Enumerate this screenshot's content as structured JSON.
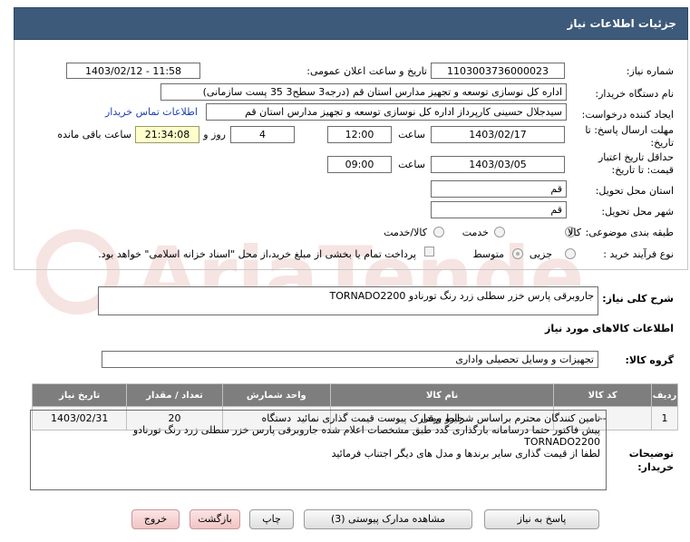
{
  "title": "جزئیات اطلاعات نیاز",
  "fields": {
    "need_number_label": "شماره نیاز:",
    "need_number": "1103003736000023",
    "announce_label": "تاریخ و ساعت اعلان عمومی:",
    "announce_value": "1403/02/12 - 11:58",
    "buyer_org_label": "نام دستگاه خریدار:",
    "buyer_org": "اداره کل نوسازی   توسعه و تجهیز مدارس استان قم (درجه3 سطح3  35 پست سازمانی)",
    "creator_label": "ایجاد کننده درخواست:",
    "creator": "سیدجلال حسینی کارپرداز اداره کل نوسازی   توسعه و تجهیز مدارس استان قم",
    "contact_link": "اطلاعات تماس خریدار",
    "reply_deadline_label": "مهلت ارسال پاسخ: تا تاریخ:",
    "reply_date": "1403/02/17",
    "time_label": "ساعت",
    "reply_time": "12:00",
    "days_value": "4",
    "days_label": "روز و",
    "remaining_time": "21:34:08",
    "remaining_label": "ساعت باقی مانده",
    "validity_label": "حداقل تاریخ اعتبار قیمت: تا تاریخ:",
    "validity_date": "1403/03/05",
    "validity_time": "09:00",
    "province_label": "استان محل تحویل:",
    "province": "قم",
    "city_label": "شهر محل تحویل:",
    "city": "قم",
    "category_label": "طبقه بندی موضوعی:",
    "cat_goods": "کالا",
    "cat_service": "خدمت",
    "cat_goods_service": "کالا/خدمت",
    "purchase_type_label": "نوع فرآیند خرید :",
    "type_minor": "جزیی",
    "type_medium": "متوسط",
    "payment_note": "پرداخت تمام یا بخشی از مبلغ خرید،از محل \"اسناد خزانه اسلامی\" خواهد بود."
  },
  "summary": {
    "label": "شرح کلی نیاز:",
    "value": "جاروبرقی پارس خزر سطلی زرد رنگ تورنادو TORNADO2200"
  },
  "goods_section_title": "اطلاعات کالاهای مورد نیاز",
  "goods_group": {
    "label": "گروه کالا:",
    "value": "تجهیزات و وسایل تحصیلی واداری"
  },
  "table": {
    "headers": [
      "ردیف",
      "کد کالا",
      "نام کالا",
      "واحد شمارش",
      "تعداد / مقدار",
      "تاریخ نیاز"
    ],
    "rows": [
      [
        "1",
        "--",
        "جارو برقی",
        "دستگاه",
        "20",
        "1403/02/31"
      ]
    ]
  },
  "notes": {
    "label": "توضیحات خریدار:",
    "lines": [
      "تامین کنندگان محترم براساس شرایط ومدارک پیوست قیمت گذاری نمائید",
      "پیش فاکتور حتما درسامانه بارگذاری گدد طبق مشخصات اعلام شده جاروبرقی پارس خزر سطلی زرد رنگ تورنادو",
      "TORNADO2200",
      "لطفا از قیمت گذاری سایر برندها و مدل های دیگر اجتناب فرمائید"
    ]
  },
  "buttons": {
    "reply": "پاسخ به نیاز",
    "attachments": "مشاهده مدارک پیوستی (3)",
    "print": "چاپ",
    "back": "بازگشت",
    "exit": "خروج"
  },
  "watermark_text": "AriaTender.neT"
}
